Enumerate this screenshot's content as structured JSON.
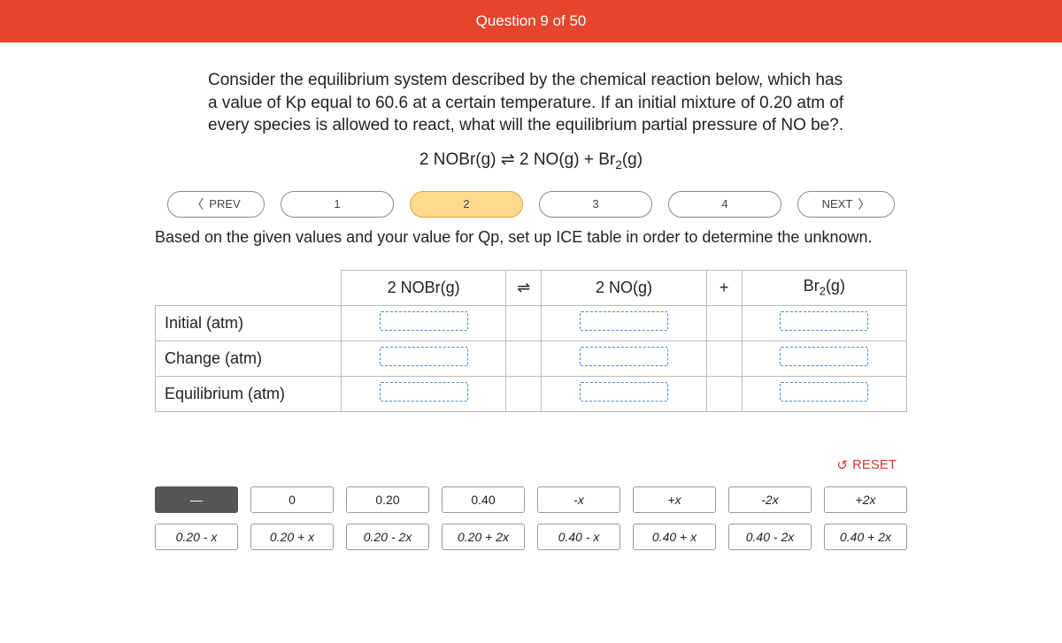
{
  "header": {
    "title": "Question 9 of 50"
  },
  "question": {
    "prompt": "Consider the equilibrium system described by the chemical reaction below, which has a value of Kp equal to 60.6 at a certain temperature. If an initial mixture of 0.20 atm of every species is allowed to react, what will the equilibrium partial pressure of NO be?.",
    "equation_left": "2 NOBr(g)",
    "equation_arrow": "⇌",
    "equation_right_a": "2 NO(g) + Br",
    "equation_right_b": "(g)",
    "equation_sub": "2"
  },
  "nav": {
    "prev": "PREV",
    "next": "NEXT",
    "steps": [
      "1",
      "2",
      "3",
      "4"
    ],
    "active_index": 1
  },
  "instruction": "Based on the given values and your value for Qp, set up ICE table in order to determine the unknown.",
  "ice": {
    "col1": "2 NOBr(g)",
    "op1": "⇌",
    "col2": "2 NO(g)",
    "op2": "+",
    "col3_a": "Br",
    "col3_sub": "2",
    "col3_b": "(g)",
    "rows": [
      "Initial (atm)",
      "Change (atm)",
      "Equilibrium (atm)"
    ]
  },
  "reset": "RESET",
  "tiles": {
    "dash": "—",
    "r1": [
      "0",
      "0.20",
      "0.40",
      "-x",
      "+x",
      "-2x",
      "+2x"
    ],
    "r2": [
      "0.20 - x",
      "0.20 + x",
      "0.20 - 2x",
      "0.20 + 2x",
      "0.40 - x",
      "0.40 + x",
      "0.40 - 2x",
      "0.40 + 2x"
    ]
  }
}
